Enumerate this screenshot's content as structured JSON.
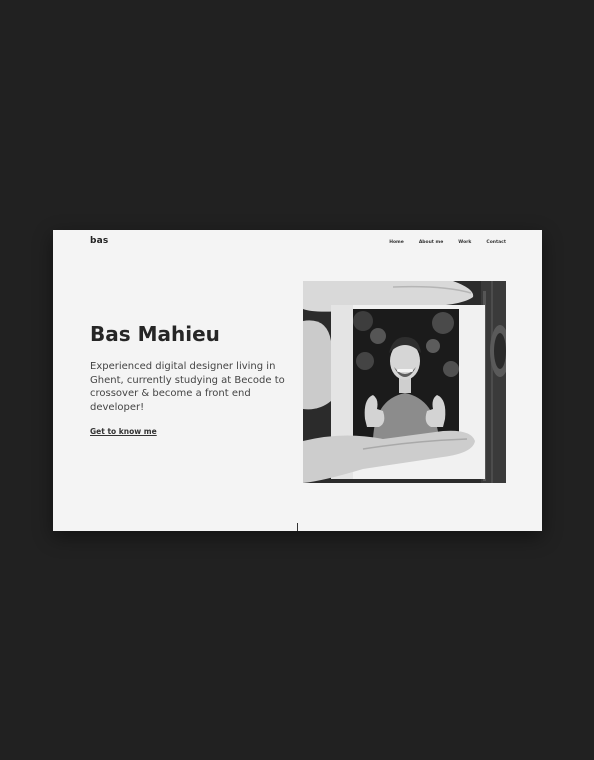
{
  "header": {
    "logo": "bas",
    "nav": [
      "Home",
      "About me",
      "Work",
      "Contact"
    ]
  },
  "hero": {
    "title": "Bas Mahieu",
    "description": "Experienced digital designer living in Ghent, currently studying at Becode to crossover & become a front end developer!",
    "cta_label": "Get to know me"
  },
  "colors": {
    "backdrop": "#212121",
    "page_background": "#f4f4f4",
    "text": "#262626"
  }
}
